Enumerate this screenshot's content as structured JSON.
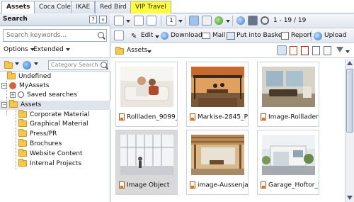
{
  "tabs": [
    "Assets",
    "Coca Cole",
    "IKAE",
    "Red Bird",
    "VIP Travel"
  ],
  "search_panel": {
    "title": "Search",
    "help_label": "?",
    "collapse_label": "«",
    "placeholder": "Search keywords...",
    "options_label": "Options",
    "extended_label": "Extended",
    "category_search_placeholder": "Category Search"
  },
  "tree": {
    "undefined": "Undefined",
    "my_assets": "MyAssets",
    "saved_searches": "Saved searches",
    "assets": "Assets",
    "children": [
      "Corporate Material",
      "Graphical Material",
      "Press/PR",
      "Brochures",
      "Website Content",
      "Internal Projects"
    ]
  },
  "toolbar": {
    "page_value": "1",
    "range_text": "1 - 19 / 19",
    "edit_label": "Edit",
    "download_label": "Download",
    "mail_label": "Mail",
    "basket_label": "Put into Basket",
    "report_label": "Report",
    "upload_label": "Upload",
    "breadcrumb_label": "Assets"
  },
  "assets": [
    {
      "label": "Rollladen_9099_",
      "highlight": false
    },
    {
      "label": "Markise-2845_P",
      "highlight": false
    },
    {
      "label": "Image-Rollladen",
      "highlight": false
    },
    {
      "label": "Image Object",
      "highlight": true
    },
    {
      "label": "image-Aussenja",
      "highlight": false
    },
    {
      "label": "Garage_Hoftor_S",
      "highlight": false
    }
  ],
  "colors": {
    "accent_tab": "#ffff40",
    "folder": "#f5c84c",
    "border": "#9eaec6"
  }
}
